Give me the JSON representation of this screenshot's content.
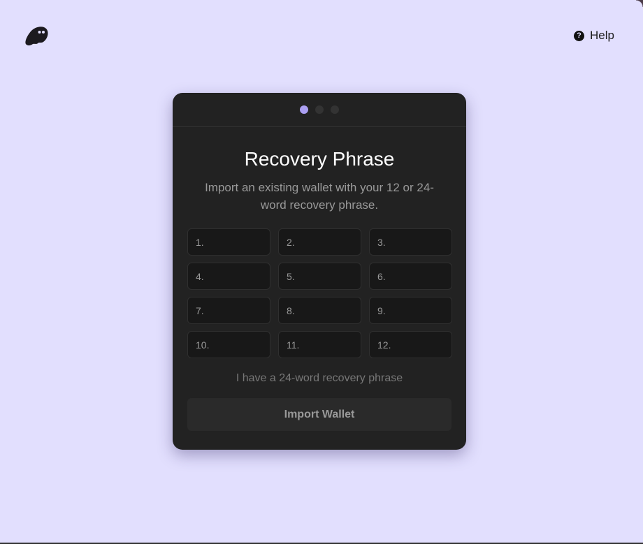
{
  "header": {
    "logo_icon": "ghost-logo-icon",
    "help_icon": "question-circle-icon",
    "help_label": "Help"
  },
  "card": {
    "steps": [
      {
        "state": "active"
      },
      {
        "state": "inactive"
      },
      {
        "state": "inactive"
      }
    ],
    "accent_color": "#ab9ff2",
    "title": "Recovery Phrase",
    "subtitle": "Import an existing wallet with your 12 or 24-word recovery phrase.",
    "words": [
      {
        "placeholder": "1.",
        "value": ""
      },
      {
        "placeholder": "2.",
        "value": ""
      },
      {
        "placeholder": "3.",
        "value": ""
      },
      {
        "placeholder": "4.",
        "value": ""
      },
      {
        "placeholder": "5.",
        "value": ""
      },
      {
        "placeholder": "6.",
        "value": ""
      },
      {
        "placeholder": "7.",
        "value": ""
      },
      {
        "placeholder": "8.",
        "value": ""
      },
      {
        "placeholder": "9.",
        "value": ""
      },
      {
        "placeholder": "10.",
        "value": ""
      },
      {
        "placeholder": "11.",
        "value": ""
      },
      {
        "placeholder": "12.",
        "value": ""
      }
    ],
    "toggle_label": "I have a 24-word recovery phrase",
    "import_button_label": "Import Wallet"
  }
}
